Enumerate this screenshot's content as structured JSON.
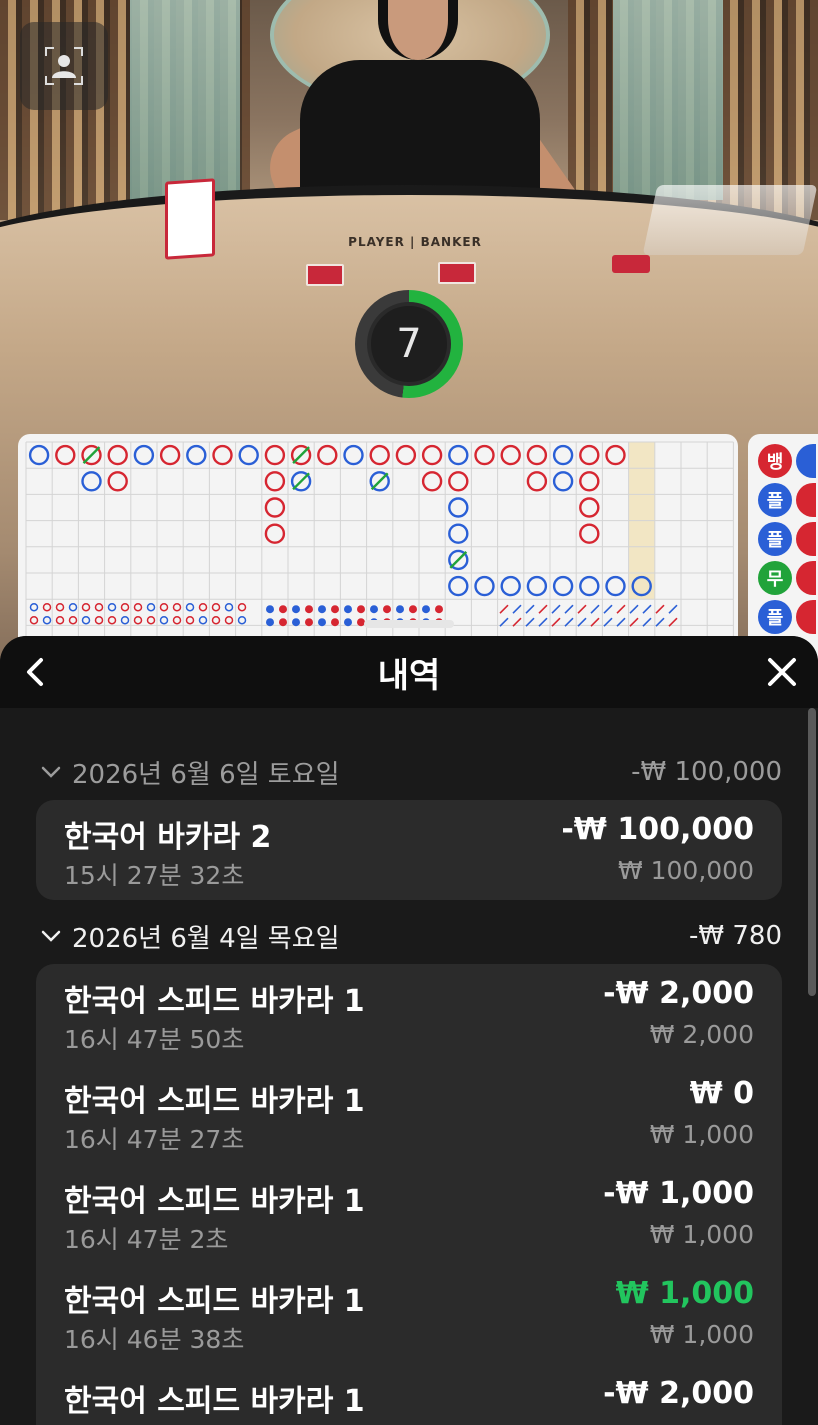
{
  "video": {
    "table_label": "PLAYER | BANKER",
    "timer_value": "7",
    "timer_progress": 0.52,
    "camera_icon": "user-camera-icon"
  },
  "scoreboard": {
    "side_badges": [
      {
        "label": "뱅",
        "color": "#d62631"
      },
      {
        "label": "플",
        "color": "#2a5fd6"
      },
      {
        "label": "플",
        "color": "#2a5fd6"
      },
      {
        "label": "무",
        "color": "#21a33a"
      },
      {
        "label": "플",
        "color": "#2a5fd6"
      }
    ],
    "colors": {
      "player": "#2a5fd6",
      "banker": "#d62631",
      "tie": "#21a33a",
      "highlight": "#f2e6c4"
    }
  },
  "history": {
    "title": "내역",
    "back_icon": "chevron-left-icon",
    "close_icon": "close-icon",
    "groups": [
      {
        "date": "2026년 6월 6일 토요일",
        "total": "-₩ 100,000",
        "items": [
          {
            "name": "한국어 바카라 2",
            "time": "15시 27분 32초",
            "net": "-₩ 100,000",
            "stake": "₩ 100,000",
            "win": false
          }
        ]
      },
      {
        "date": "2026년 6월 4일 목요일",
        "total": "-₩ 780",
        "items": [
          {
            "name": "한국어 스피드 바카라 1",
            "time": "16시 47분 50초",
            "net": "-₩ 2,000",
            "stake": "₩ 2,000",
            "win": false
          },
          {
            "name": "한국어 스피드 바카라 1",
            "time": "16시 47분 27초",
            "net": "₩ 0",
            "stake": "₩ 1,000",
            "win": false
          },
          {
            "name": "한국어 스피드 바카라 1",
            "time": "16시 47분 2초",
            "net": "-₩ 1,000",
            "stake": "₩ 1,000",
            "win": false
          },
          {
            "name": "한국어 스피드 바카라 1",
            "time": "16시 46분 38초",
            "net": "₩ 1,000",
            "stake": "₩ 1,000",
            "win": true
          },
          {
            "name": "한국어 스피드 바카라 1",
            "time": "",
            "net": "-₩ 2,000",
            "stake": "",
            "win": false
          }
        ]
      }
    ],
    "win_color": "#22c55e"
  }
}
